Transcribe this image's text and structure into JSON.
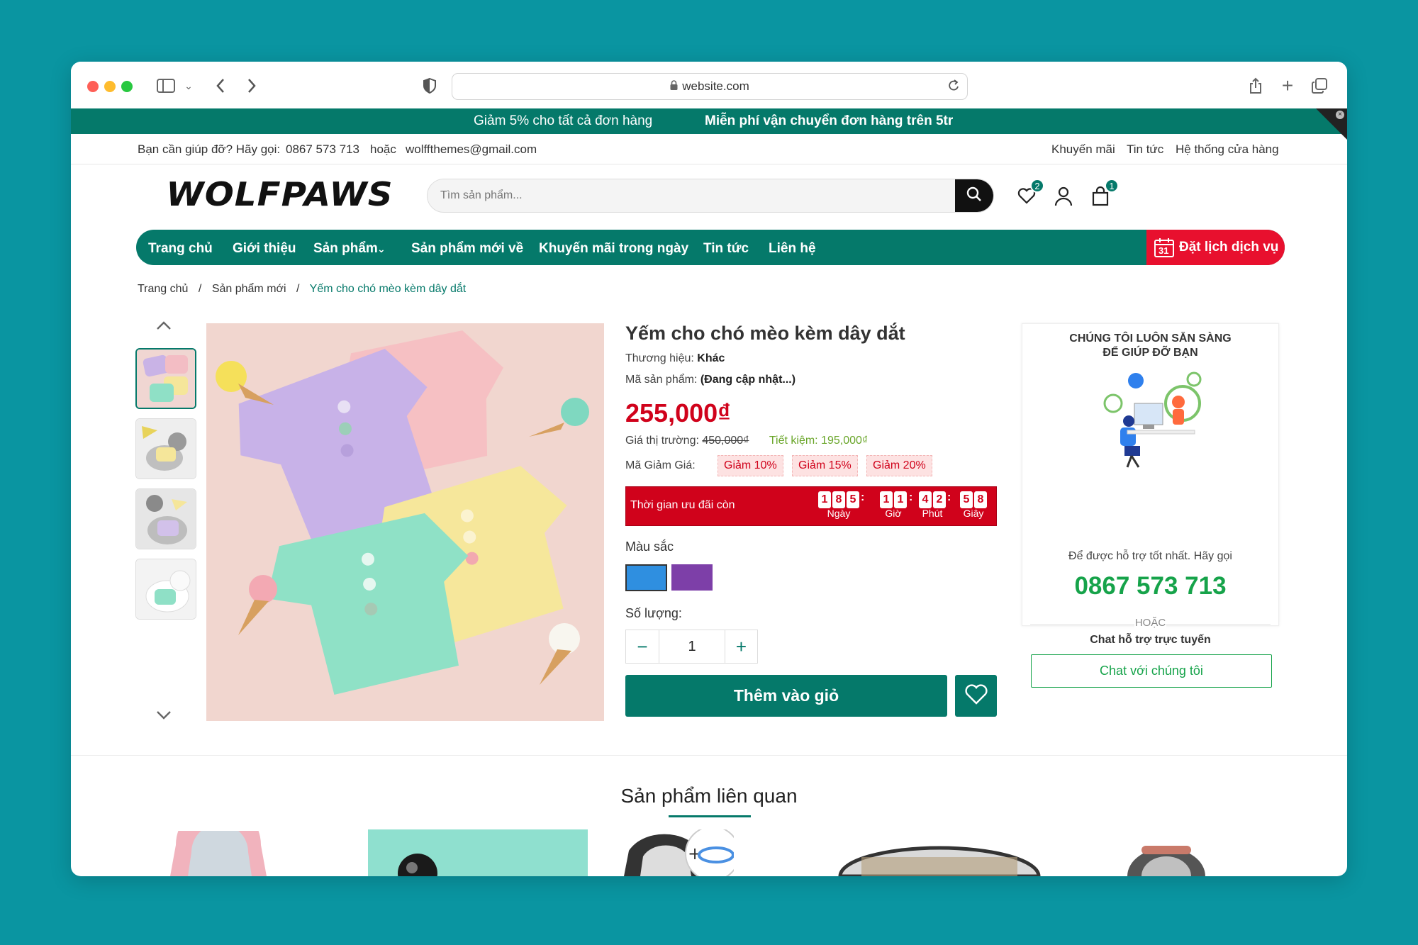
{
  "browser": {
    "url": "website.com"
  },
  "promo": {
    "left": "Giảm 5% cho tất cả đơn hàng",
    "right": "Miễn phí vận chuyển đơn hàng trên 5tr"
  },
  "topbar": {
    "help_text": "Bạn cần giúp đỡ? Hãy gọi:",
    "phone": "0867 573 713",
    "or": "hoặc",
    "email": "wolffthemes@gmail.com",
    "links": [
      "Khuyến mãi",
      "Tin tức",
      "Hệ thống cửa hàng"
    ]
  },
  "header": {
    "logo": "WOLFPAWS",
    "search_placeholder": "Tìm sản phẩm...",
    "wishlist_count": "2",
    "cart_count": "1"
  },
  "nav": {
    "items": [
      "Trang chủ",
      "Giới thiệu",
      "Sản phẩm",
      "Sản phẩm mới về",
      "Khuyến mãi trong ngày",
      "Tin tức",
      "Liên hệ"
    ],
    "cta": "Đặt lịch dịch vụ",
    "calendar_day": "31"
  },
  "breadcrumb": [
    "Trang chủ",
    "Sản phẩm mới",
    "Yếm cho chó mèo kèm dây dắt"
  ],
  "product": {
    "title": "Yếm cho chó mèo kèm dây dắt",
    "brand_label": "Thương hiệu:",
    "brand": "Khác",
    "sku_label": "Mã sản phẩm:",
    "sku": "(Đang cập nhật...)",
    "price": "255,000₫",
    "market_label": "Giá thị trường:",
    "market_price": "450,000₫",
    "saving": "Tiết kiệm: 195,000₫",
    "coupon_label": "Mã Giảm Giá:",
    "coupons": [
      "Giảm 10%",
      "Giảm 15%",
      "Giảm 20%"
    ],
    "countdown_label": "Thời gian ưu đãi còn",
    "countdown": {
      "days": [
        "1",
        "8",
        "5"
      ],
      "hours": [
        "1",
        "1"
      ],
      "minutes": [
        "4",
        "2"
      ],
      "seconds": [
        "5",
        "8"
      ],
      "labels": [
        "Ngày",
        "Giờ",
        "Phút",
        "Giây"
      ]
    },
    "color_label": "Màu sắc",
    "colors": [
      "#2f8fe0",
      "#7d3fa8"
    ],
    "qty_label": "Số lượng:",
    "qty": "1",
    "add_to_cart": "Thêm vào giỏ"
  },
  "support": {
    "title_line1": "CHÚNG TÔI LUÔN SẴN SÀNG",
    "title_line2": "ĐỂ GIÚP ĐỠ BẠN",
    "subtitle": "Để được hỗ trợ tốt nhất. Hãy gọi",
    "phone": "0867 573 713",
    "or": "HOẶC",
    "chat_text": "Chat hỗ trợ trực tuyến",
    "chat_button": "Chat với chúng tôi"
  },
  "related": {
    "title": "Sản phẩm liên quan"
  },
  "colors": {
    "brand_green": "#05796a",
    "price_red": "#d0021b",
    "support_phone_green": "#16a34a"
  }
}
